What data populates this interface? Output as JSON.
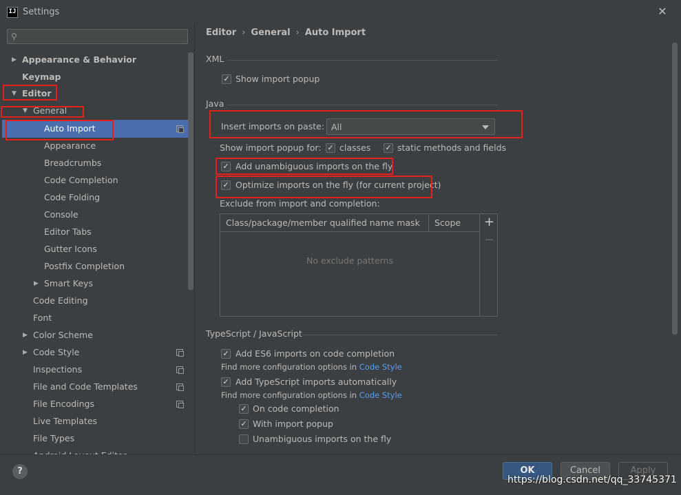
{
  "window": {
    "title": "Settings",
    "app_icon_label": "IJ"
  },
  "breadcrumb": [
    "Editor",
    "General",
    "Auto Import"
  ],
  "sidebar": {
    "search_placeholder": "",
    "items": [
      {
        "label": "Appearance & Behavior",
        "bold": true
      },
      {
        "label": "Keymap",
        "bold": true
      },
      {
        "label": "Editor",
        "bold": true
      },
      {
        "label": "General"
      },
      {
        "label": "Auto Import",
        "selected": true
      },
      {
        "label": "Appearance"
      },
      {
        "label": "Breadcrumbs"
      },
      {
        "label": "Code Completion"
      },
      {
        "label": "Code Folding"
      },
      {
        "label": "Console"
      },
      {
        "label": "Editor Tabs"
      },
      {
        "label": "Gutter Icons"
      },
      {
        "label": "Postfix Completion"
      },
      {
        "label": "Smart Keys"
      },
      {
        "label": "Code Editing"
      },
      {
        "label": "Font"
      },
      {
        "label": "Color Scheme"
      },
      {
        "label": "Code Style"
      },
      {
        "label": "Inspections"
      },
      {
        "label": "File and Code Templates"
      },
      {
        "label": "File Encodings"
      },
      {
        "label": "Live Templates"
      },
      {
        "label": "File Types"
      },
      {
        "label": "Android Layout Editor"
      }
    ]
  },
  "xml": {
    "title": "XML",
    "show_import_popup": {
      "label": "Show import popup",
      "checked": true
    }
  },
  "java": {
    "title": "Java",
    "insert_imports_label": "Insert imports on paste:",
    "insert_imports_value": "All",
    "show_popup_for_label": "Show import popup for:",
    "classes": {
      "label": "classes",
      "checked": true
    },
    "static_methods": {
      "label": "static methods and fields",
      "checked": true
    },
    "add_unambiguous": {
      "label": "Add unambiguous imports on the fly",
      "checked": true
    },
    "optimize_imports": {
      "label": "Optimize imports on the fly (for current project)",
      "checked": true
    },
    "exclude_label": "Exclude from import and completion:",
    "table": {
      "columns": [
        "Class/package/member qualified name mask",
        "Scope"
      ],
      "empty_text": "No exclude patterns",
      "add_label": "+",
      "remove_label": "−"
    }
  },
  "typescript": {
    "title": "TypeScript / JavaScript",
    "add_es6": {
      "label": "Add ES6 imports on code completion",
      "checked": true
    },
    "find_more_1": "Find more configuration options in",
    "link_1": "Code Style",
    "add_ts": {
      "label": "Add TypeScript imports automatically",
      "checked": true
    },
    "find_more_2": "Find more configuration options in",
    "link_2": "Code Style",
    "on_completion": {
      "label": "On code completion",
      "checked": true
    },
    "with_popup": {
      "label": "With import popup",
      "checked": true
    },
    "unambiguous": {
      "label": "Unambiguous imports on the fly",
      "checked": false
    }
  },
  "buttons": {
    "help": "?",
    "ok": "OK",
    "cancel": "Cancel",
    "apply": "Apply"
  },
  "watermark": "https://blog.csdn.net/qq_33745371",
  "colors": {
    "background": "#3c3f41",
    "selection": "#4b6eaf",
    "link": "#589df6",
    "annotation": "#e8201c"
  }
}
